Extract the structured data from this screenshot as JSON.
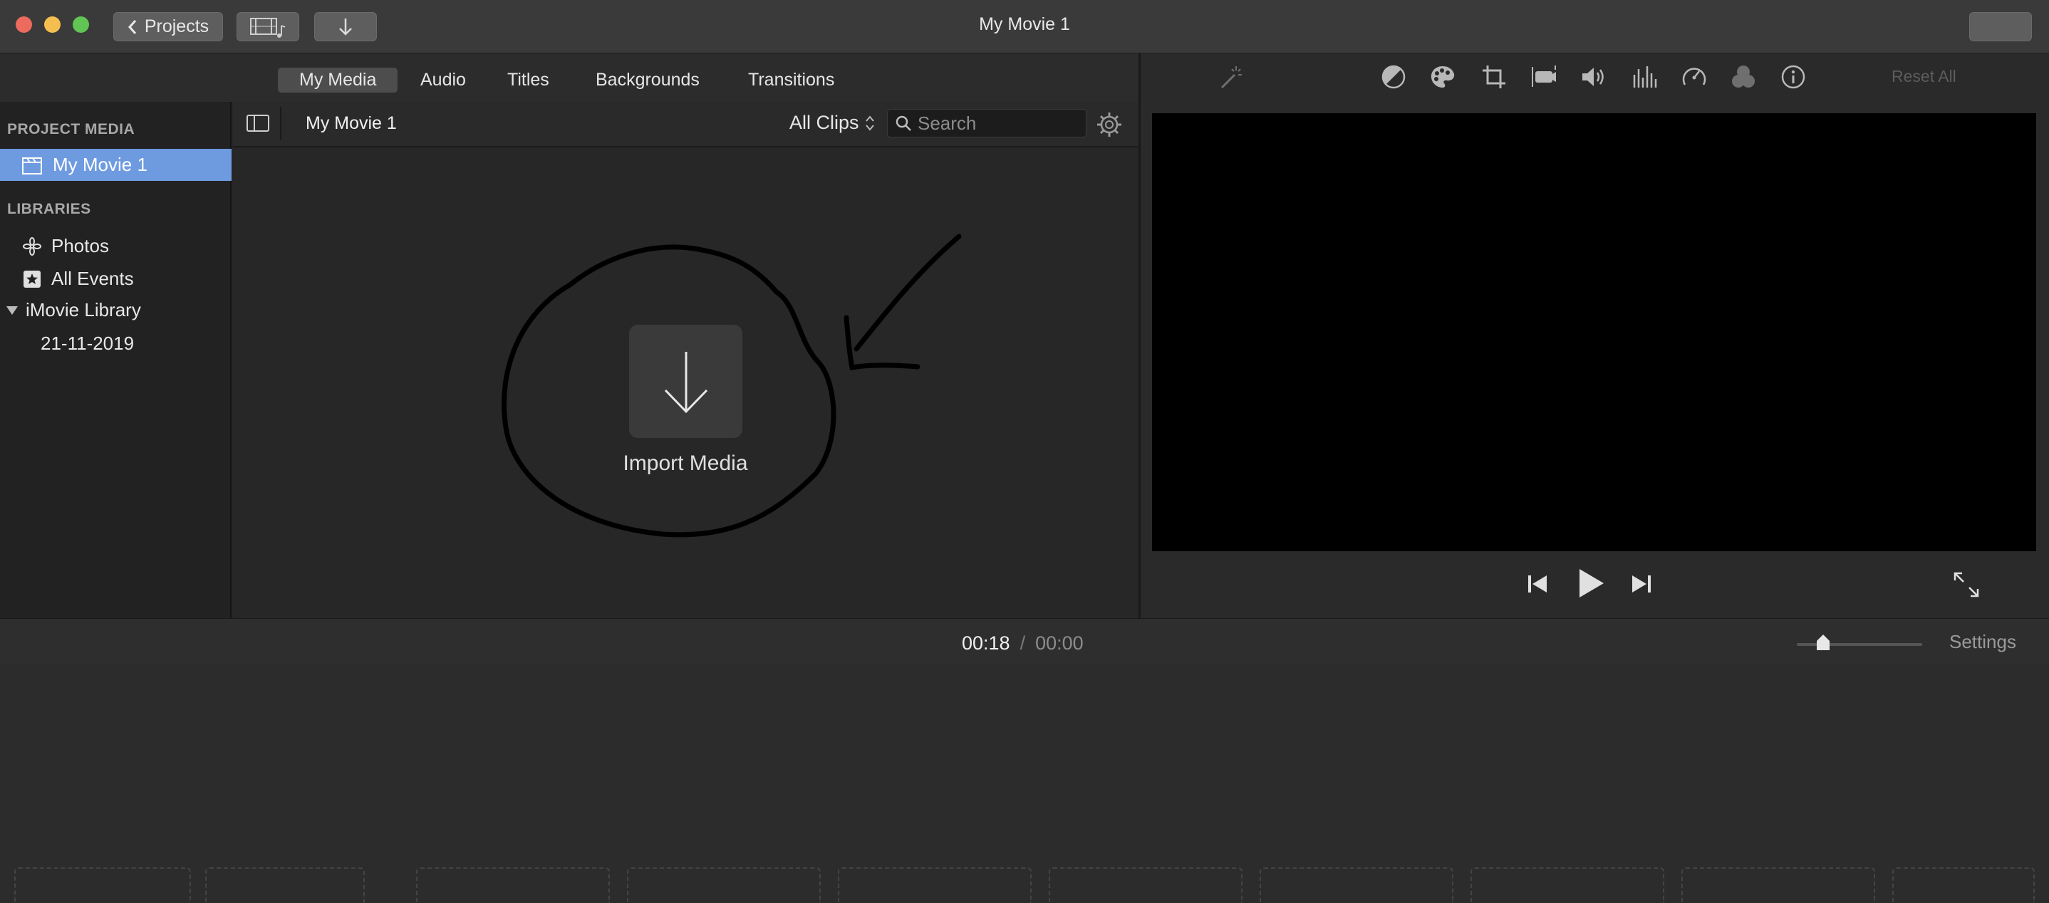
{
  "window": {
    "title": "My Movie 1"
  },
  "titlebar": {
    "projects_label": "Projects"
  },
  "tabs": [
    "My Media",
    "Audio",
    "Titles",
    "Backgrounds",
    "Transitions"
  ],
  "sidebar": {
    "project_media_heading": "PROJECT MEDIA",
    "project_item": "My Movie 1",
    "libraries_heading": "LIBRARIES",
    "photos": "Photos",
    "all_events": "All Events",
    "library_name": "iMovie Library",
    "event_date": "21-11-2019"
  },
  "browser": {
    "title": "My Movie 1",
    "filter": "All Clips",
    "search_placeholder": "Search",
    "import_label": "Import Media"
  },
  "viewer": {
    "reset_all": "Reset All"
  },
  "timeline": {
    "current_time": "00:18",
    "separator": "/",
    "total_time": "00:00",
    "settings_label": "Settings",
    "zoom_level": 0.2
  },
  "colors": {
    "accent": "#6e9be0",
    "close": "#ed6a5e",
    "minimize": "#f5bf4f",
    "zoom": "#61c554"
  },
  "icons": [
    "chevron-left-icon",
    "film-music-icon",
    "download-arrow-icon",
    "sidebar-toggle-icon",
    "search-icon",
    "gear-icon",
    "magic-wand-icon",
    "color-balance-icon",
    "palette-icon",
    "crop-icon",
    "stabilize-camera-icon",
    "volume-icon",
    "equalizer-icon",
    "speedometer-icon",
    "overlay-circles-icon",
    "info-icon",
    "skip-back-icon",
    "play-icon",
    "skip-forward-icon",
    "fullscreen-icon",
    "clapper-icon",
    "flower-icon",
    "star-icon",
    "disclosure-triangle-icon"
  ]
}
